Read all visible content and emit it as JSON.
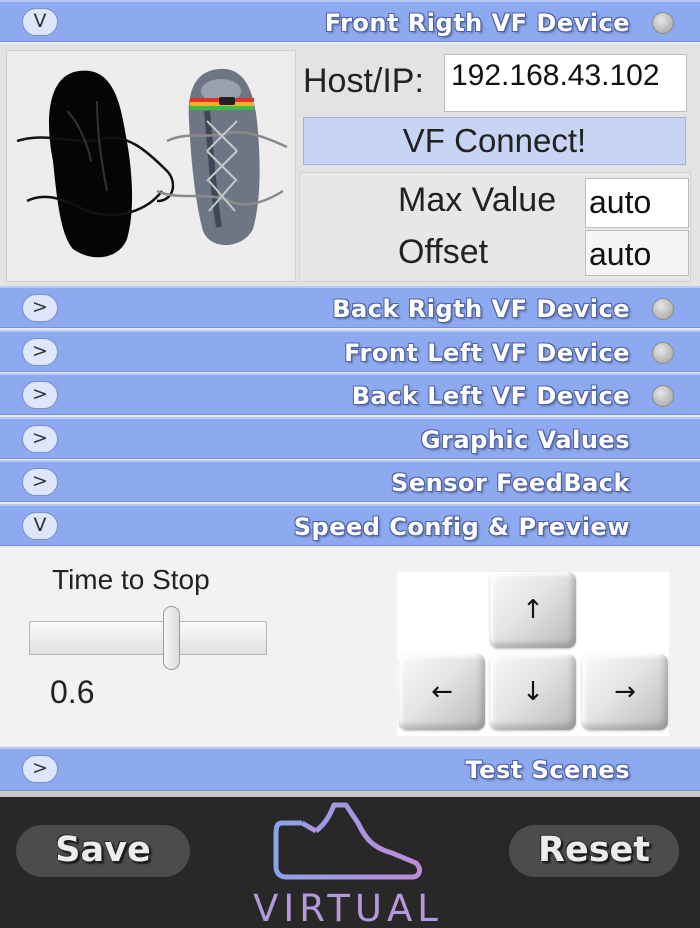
{
  "sections": {
    "front_right": {
      "title": "Front Rigth VF Device",
      "toggle": "V"
    },
    "back_right": {
      "title": "Back Rigth VF Device",
      "toggle": ">"
    },
    "front_left": {
      "title": "Front Left VF Device",
      "toggle": ">"
    },
    "back_left": {
      "title": "Back Left VF Device",
      "toggle": ">"
    },
    "graphic_values": {
      "title": "Graphic Values",
      "toggle": ">"
    },
    "sensor_feedback": {
      "title": "Sensor FeedBack",
      "toggle": ">"
    },
    "speed_config": {
      "title": "Speed Config & Preview",
      "toggle": "V"
    },
    "test_scenes": {
      "title": "Test Scenes",
      "toggle": ">"
    }
  },
  "device": {
    "host_label": "Host/IP:",
    "host_value": "192.168.43.102",
    "connect_label": "VF Connect!",
    "max_value_label": "Max Value",
    "max_value": "auto",
    "offset_label": "Offset",
    "offset_value": "auto",
    "status_color": "#bdbdbd"
  },
  "speed": {
    "title": "Time to Stop",
    "value": "0.6",
    "slider_fraction": 0.6
  },
  "keys": {
    "up": "↑",
    "left": "←",
    "down": "↓",
    "right": "→"
  },
  "footer": {
    "save_label": "Save",
    "reset_label": "Reset",
    "brand": "VIRTUAL FEET"
  },
  "colors": {
    "header": "#8da9ef",
    "footer": "#282828",
    "brand_gradient_start": "#8aa4e6",
    "brand_gradient_end": "#c08ad8"
  }
}
